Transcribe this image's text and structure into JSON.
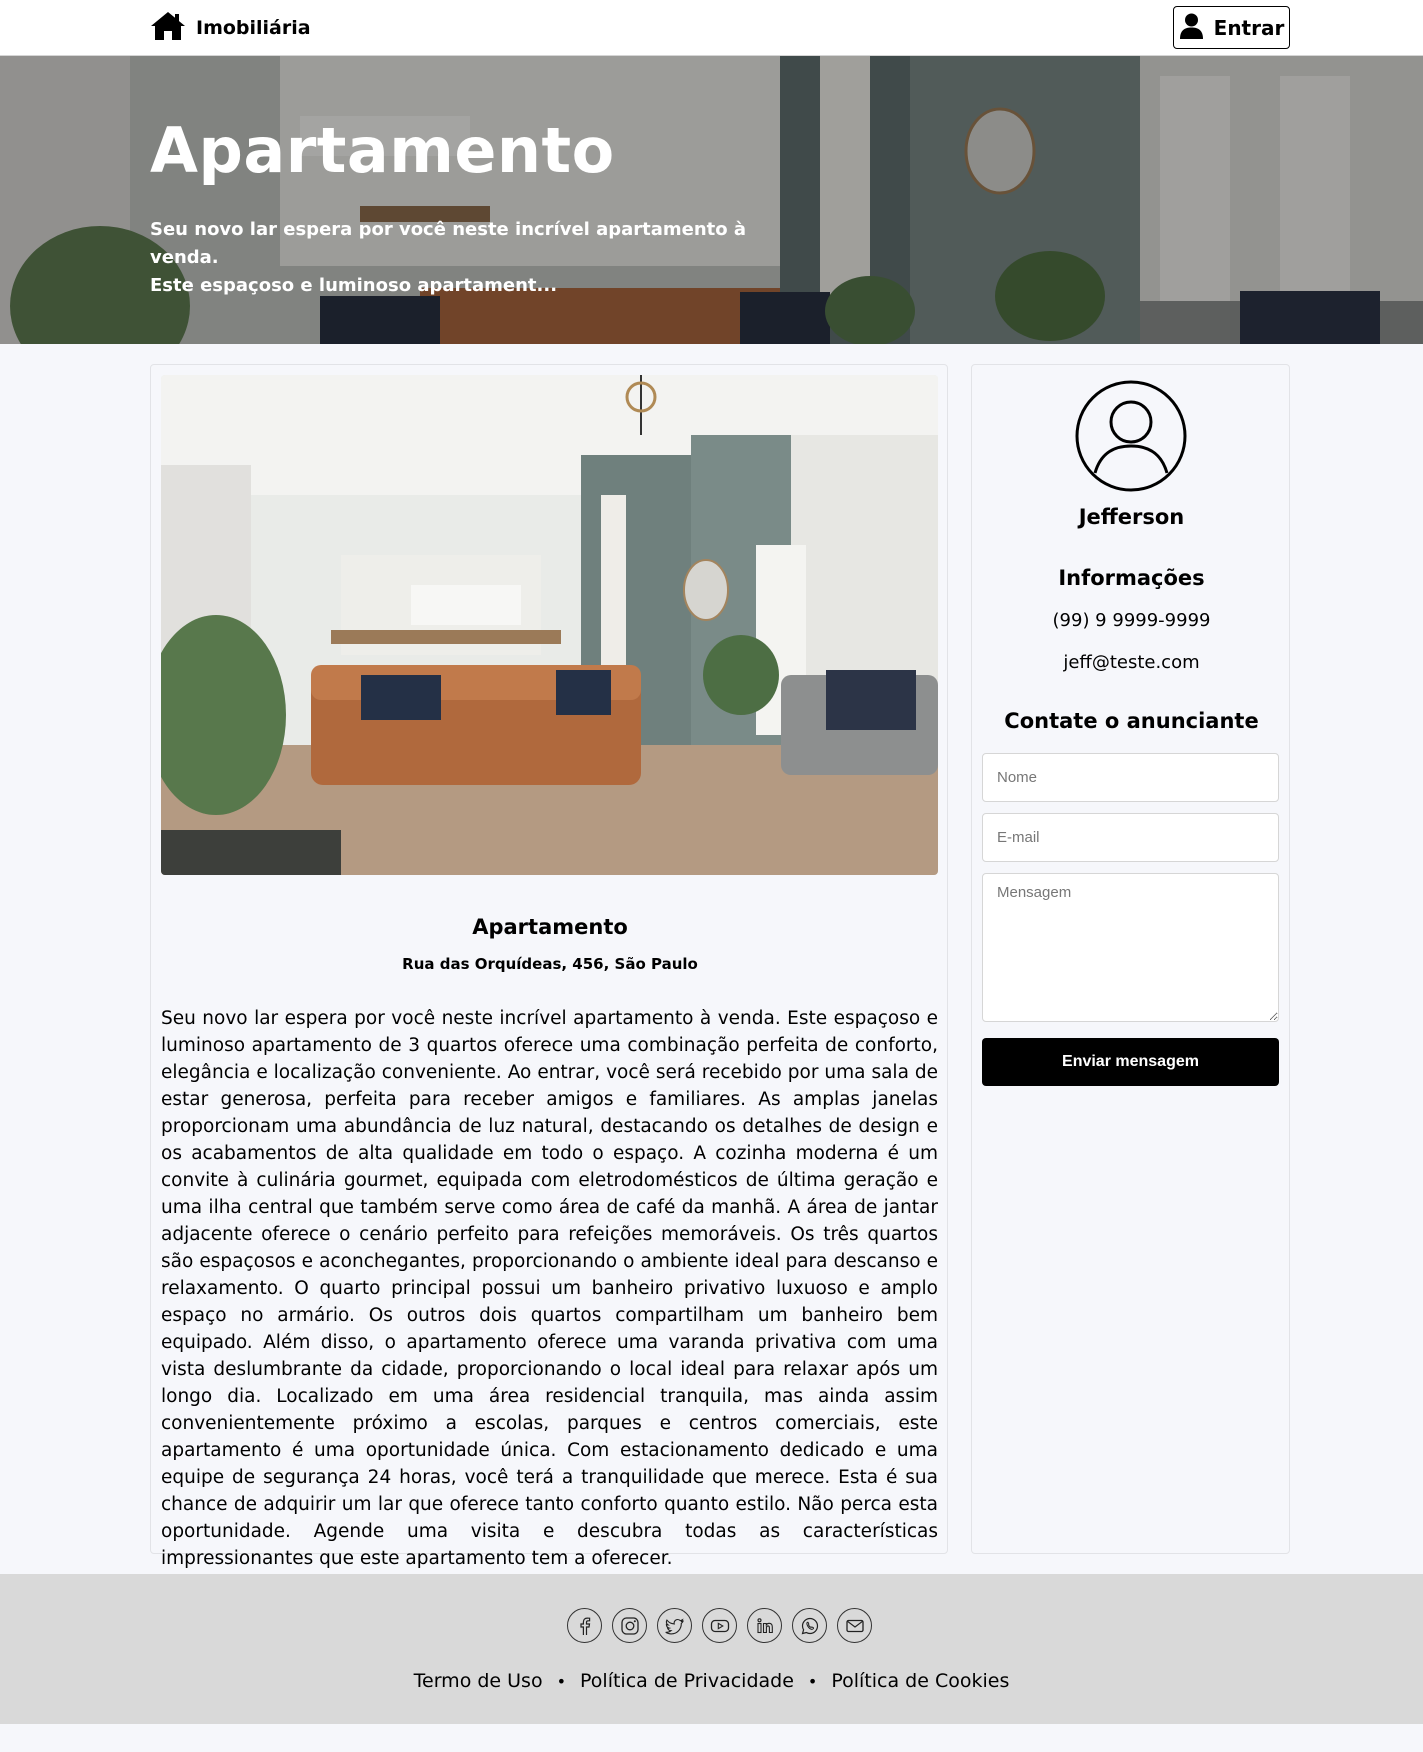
{
  "navbar": {
    "brand_icon": "house-icon",
    "brand_label": "Imobiliária",
    "login_icon": "user-icon",
    "login_label": "Entrar"
  },
  "hero": {
    "title": "Apartamento",
    "text_line1": "Seu novo lar espera por você neste incrível apartamento à venda.",
    "text_line2": "Este espaçoso e luminoso apartament..."
  },
  "property": {
    "title": "Apartamento",
    "address": "Rua das Orquídeas, 456, São Paulo",
    "description": "Seu novo lar espera por você neste incrível apartamento à venda. Este espaçoso e luminoso apartamento de 3 quartos oferece uma combinação perfeita de conforto, elegância e localização conveniente. Ao entrar, você será recebido por uma sala de estar generosa, perfeita para receber amigos e familiares. As amplas janelas proporcionam uma abundância de luz natural, destacando os detalhes de design e os acabamentos de alta qualidade em todo o espaço. A cozinha moderna é um convite à culinária gourmet, equipada com eletrodomésticos de última geração e uma ilha central que também serve como área de café da manhã. A área de jantar adjacente oferece o cenário perfeito para refeições memoráveis. Os três quartos são espaçosos e aconchegantes, proporcionando o ambiente ideal para descanso e relaxamento. O quarto principal possui um banheiro privativo luxuoso e amplo espaço no armário. Os outros dois quartos compartilham um banheiro bem equipado. Além disso, o apartamento oferece uma varanda privativa com uma vista deslumbrante da cidade, proporcionando o local ideal para relaxar após um longo dia. Localizado em uma área residencial tranquila, mas ainda assim convenientemente próximo a escolas, parques e centros comerciais, este apartamento é uma oportunidade única. Com estacionamento dedicado e uma equipe de segurança 24 horas, você terá a tranquilidade que merece. Esta é sua chance de adquirir um lar que oferece tanto conforto quanto estilo. Não perca esta oportunidade. Agende uma visita e descubra todas as características impressionantes que este apartamento tem a oferecer."
  },
  "agent": {
    "avatar_icon": "user-circle-icon",
    "name": "Jefferson",
    "info_heading": "Informações",
    "phone": "(99) 9 9999-9999",
    "email": "jeff@teste.com"
  },
  "contact_form": {
    "heading": "Contate o anunciante",
    "name_placeholder": "Nome",
    "email_placeholder": "E-mail",
    "message_placeholder": "Mensagem",
    "submit_label": "Enviar mensagem"
  },
  "footer": {
    "social_icons": [
      "facebook-icon",
      "instagram-icon",
      "twitter-icon",
      "youtube-icon",
      "linkedin-icon",
      "whatsapp-icon",
      "email-icon"
    ],
    "links": [
      "Termo de Uso",
      "Política de Privacidade",
      "Política de Cookies"
    ],
    "separator": "•"
  },
  "colors": {
    "page_background": "#f6f7fb",
    "footer_background": "#d9d9d9",
    "button_dark": "#000000",
    "text_light": "#ffffff"
  }
}
